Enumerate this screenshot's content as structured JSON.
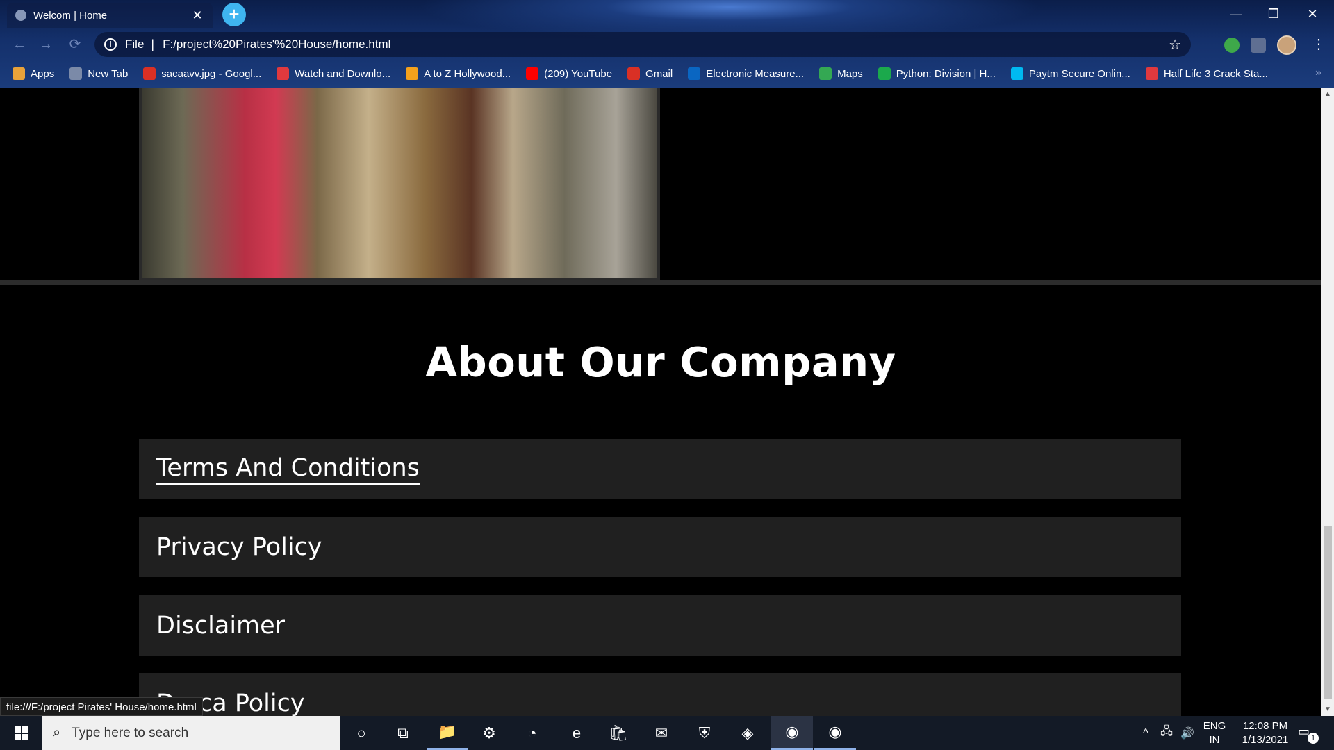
{
  "browser": {
    "tab": {
      "title": "Welcom | Home",
      "close": "✕"
    },
    "new_tab": "+",
    "window": {
      "minimize": "—",
      "restore": "❐",
      "close": "✕"
    },
    "nav": {
      "back": "←",
      "forward": "→",
      "reload": "⟳"
    },
    "address": {
      "info": "i",
      "scheme": "File",
      "separator": "|",
      "url": "F:/project%20Pirates'%20House/home.html",
      "star": "☆"
    },
    "menu": "⋮",
    "bookmarks": [
      {
        "label": "Apps",
        "icon": "apps-grid-icon",
        "color": "#e8a23a"
      },
      {
        "label": "New Tab",
        "icon": "globe-icon",
        "color": "#7b8aa8"
      },
      {
        "label": "sacaavv.jpg - Googl...",
        "icon": "google-photos-icon",
        "color": "#d93025"
      },
      {
        "label": "Watch and Downlo...",
        "icon": "hd-icon",
        "color": "#e0393e"
      },
      {
        "label": "A to Z Hollywood...",
        "icon": "m-logo-icon",
        "color": "#f4a11c"
      },
      {
        "label": "(209) YouTube",
        "icon": "youtube-icon",
        "color": "#ff0000"
      },
      {
        "label": "Gmail",
        "icon": "gmail-icon",
        "color": "#d93025"
      },
      {
        "label": "Electronic Measure...",
        "icon": "linkedin-icon",
        "color": "#0a66c2"
      },
      {
        "label": "Maps",
        "icon": "maps-icon",
        "color": "#34a853"
      },
      {
        "label": "Python: Division | H...",
        "icon": "hackerrank-icon",
        "color": "#1ba94c"
      },
      {
        "label": "Paytm Secure Onlin...",
        "icon": "paytm-icon",
        "color": "#00b9f1"
      },
      {
        "label": "Half Life 3 Crack Sta...",
        "icon": "opera-icon",
        "color": "#e0393e"
      }
    ],
    "bookmarks_overflow": "»",
    "status_url": "file:///F:/project Pirates' House/home.html"
  },
  "page": {
    "about_title": "About Our Company",
    "policies": [
      {
        "label": "Terms And Conditions",
        "linked": true
      },
      {
        "label": "Privacy Policy",
        "linked": false
      },
      {
        "label": "Disclaimer",
        "linked": false
      },
      {
        "label": "Dmca Policy",
        "linked": false
      }
    ]
  },
  "taskbar": {
    "search_placeholder": "Type here to search",
    "apps": [
      {
        "name": "cortana-icon",
        "glyph": "○"
      },
      {
        "name": "task-view-icon",
        "glyph": "⧉"
      },
      {
        "name": "file-explorer-icon",
        "glyph": "📁"
      },
      {
        "name": "settings-gear-icon",
        "glyph": "⚙"
      },
      {
        "name": "clock-app-icon",
        "glyph": "◔"
      },
      {
        "name": "edge-browser-icon",
        "glyph": "e"
      },
      {
        "name": "microsoft-store-icon",
        "glyph": "🛍"
      },
      {
        "name": "mail-icon",
        "glyph": "✉"
      },
      {
        "name": "windows-security-icon",
        "glyph": "⛨"
      },
      {
        "name": "nvidia-icon",
        "glyph": "◈"
      },
      {
        "name": "chrome-icon",
        "glyph": "◉"
      },
      {
        "name": "chrome-profile-icon",
        "glyph": "◉"
      }
    ],
    "tray": {
      "chevron": "^",
      "network": "🖧",
      "volume": "🔊"
    },
    "language": {
      "line1": "ENG",
      "line2": "IN"
    },
    "clock": {
      "time": "12:08 PM",
      "date": "1/13/2021"
    },
    "notification_count": "1"
  }
}
